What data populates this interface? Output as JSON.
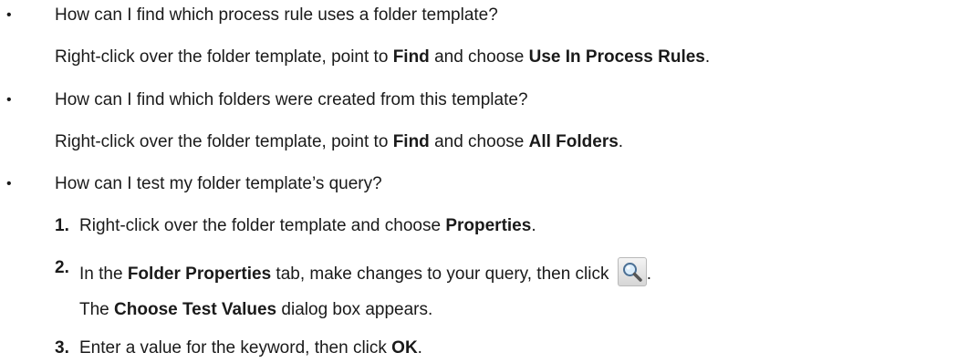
{
  "faq": [
    {
      "bullet": "•",
      "question": "How can I find which process rule uses a folder template?",
      "answer": {
        "pre": "Right-click over the folder template, point to ",
        "b1": "Find",
        "mid": " and choose ",
        "b2": "Use In Process Rules",
        "post": "."
      }
    },
    {
      "bullet": "•",
      "question": "How can I find which folders were created from this template?",
      "answer": {
        "pre": "Right-click over the folder template, point to ",
        "b1": "Find",
        "mid": " and choose ",
        "b2": "All Folders",
        "post": "."
      }
    },
    {
      "bullet": "•",
      "question": "How can I test my folder template’s query?",
      "steps": [
        {
          "num": "1.",
          "pre": "Right-click over the folder template and choose ",
          "b1": "Properties",
          "post": "."
        },
        {
          "num": "2.",
          "pre": "In the ",
          "b1": "Folder Properties",
          "mid": " tab, make changes to your query, then click ",
          "icon": "magnifier-search-icon",
          "post": ".",
          "note": {
            "pre": "The ",
            "b1": "Choose Test Values",
            "post": " dialog box appears."
          }
        },
        {
          "num": "3.",
          "pre": "Enter a value for the keyword, then click ",
          "b1": "OK",
          "post": "."
        }
      ]
    }
  ]
}
